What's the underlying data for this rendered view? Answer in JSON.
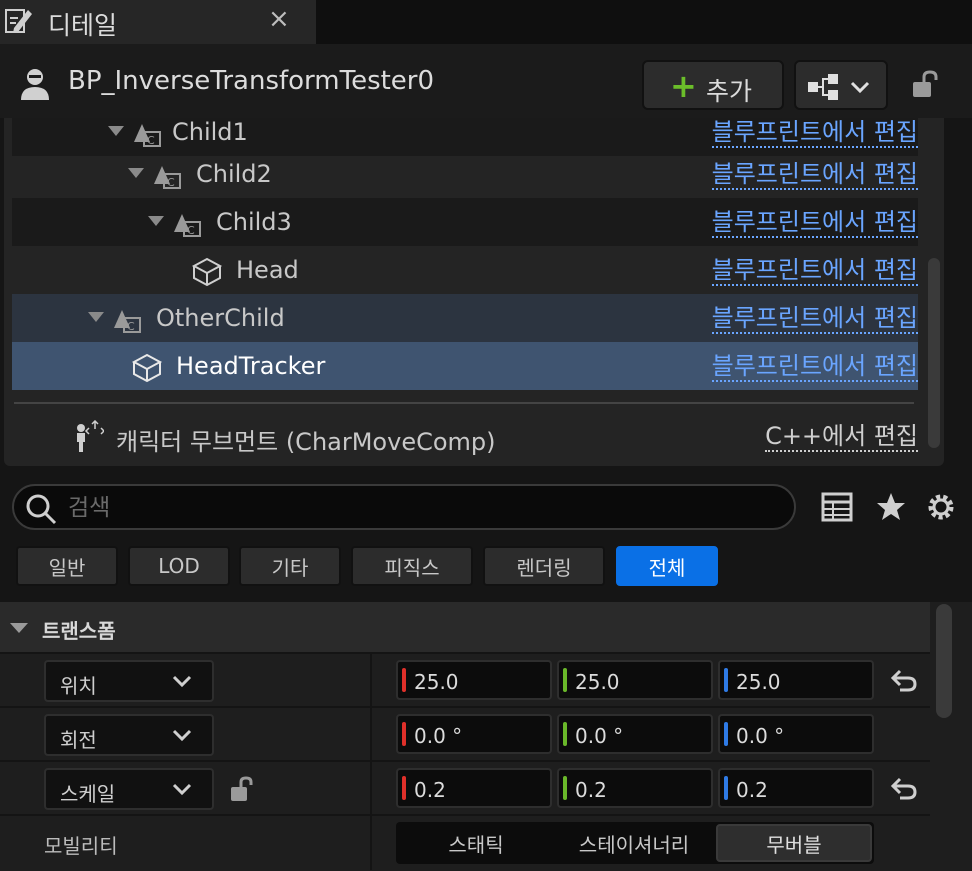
{
  "tab": {
    "title": "디테일",
    "close": "×",
    "icon": "pencil-icon"
  },
  "header": {
    "name": "BP_InverseTransformTester0",
    "add_plus": "+",
    "add_label": "추가",
    "avatar_icon": "pawn-avatar-icon",
    "blueprint_icon": "blueprint-graph-icon",
    "lock_icon": "unlock-icon"
  },
  "tree": {
    "rows": [
      {
        "label": "Child1",
        "edit": "블루프린트에서 편집",
        "icon": "child-actor-icon"
      },
      {
        "label": "Child2",
        "edit": "블루프린트에서 편집",
        "icon": "child-actor-icon"
      },
      {
        "label": "Child3",
        "edit": "블루프린트에서 편집",
        "icon": "child-actor-icon"
      },
      {
        "label": "Head",
        "edit": "블루프린트에서 편집",
        "icon": "static-mesh-cube-icon"
      },
      {
        "label": "OtherChild",
        "edit": "블루프린트에서 편집",
        "icon": "child-actor-icon"
      },
      {
        "label": "HeadTracker",
        "edit": "블루프린트에서 편집",
        "icon": "static-mesh-cube-icon"
      }
    ],
    "cpp_row": {
      "label": "캐릭터 무브먼트 (CharMoveComp)",
      "edit": "C++에서 편집",
      "icon": "character-movement-icon"
    }
  },
  "search": {
    "placeholder": "검색",
    "icon": "search-icon"
  },
  "toolbar_icons": [
    "table-view-icon",
    "favorite-star-icon",
    "settings-gear-icon"
  ],
  "filters": [
    "일반",
    "LOD",
    "기타",
    "피직스",
    "렌더링",
    "전체"
  ],
  "active_filter": "전체",
  "colors": {
    "accent": "#0a70e6",
    "link": "#6aa5ff",
    "x_axis": "#e0302a",
    "y_axis": "#6ab82a",
    "z_axis": "#2f7be6",
    "selected_row": "#3f5470"
  },
  "details": {
    "category": "트랜스폼",
    "location": {
      "label": "위치",
      "x": "25.0",
      "y": "25.0",
      "z": "25.0"
    },
    "rotation": {
      "label": "회전",
      "x": "0.0 °",
      "y": "0.0 °",
      "z": "0.0 °"
    },
    "scale": {
      "label": "스케일",
      "x": "0.2",
      "y": "0.2",
      "z": "0.2"
    },
    "mobility": {
      "label": "모빌리티",
      "options": [
        "스태틱",
        "스테이셔너리",
        "무버블"
      ],
      "selected": "무버블"
    }
  }
}
